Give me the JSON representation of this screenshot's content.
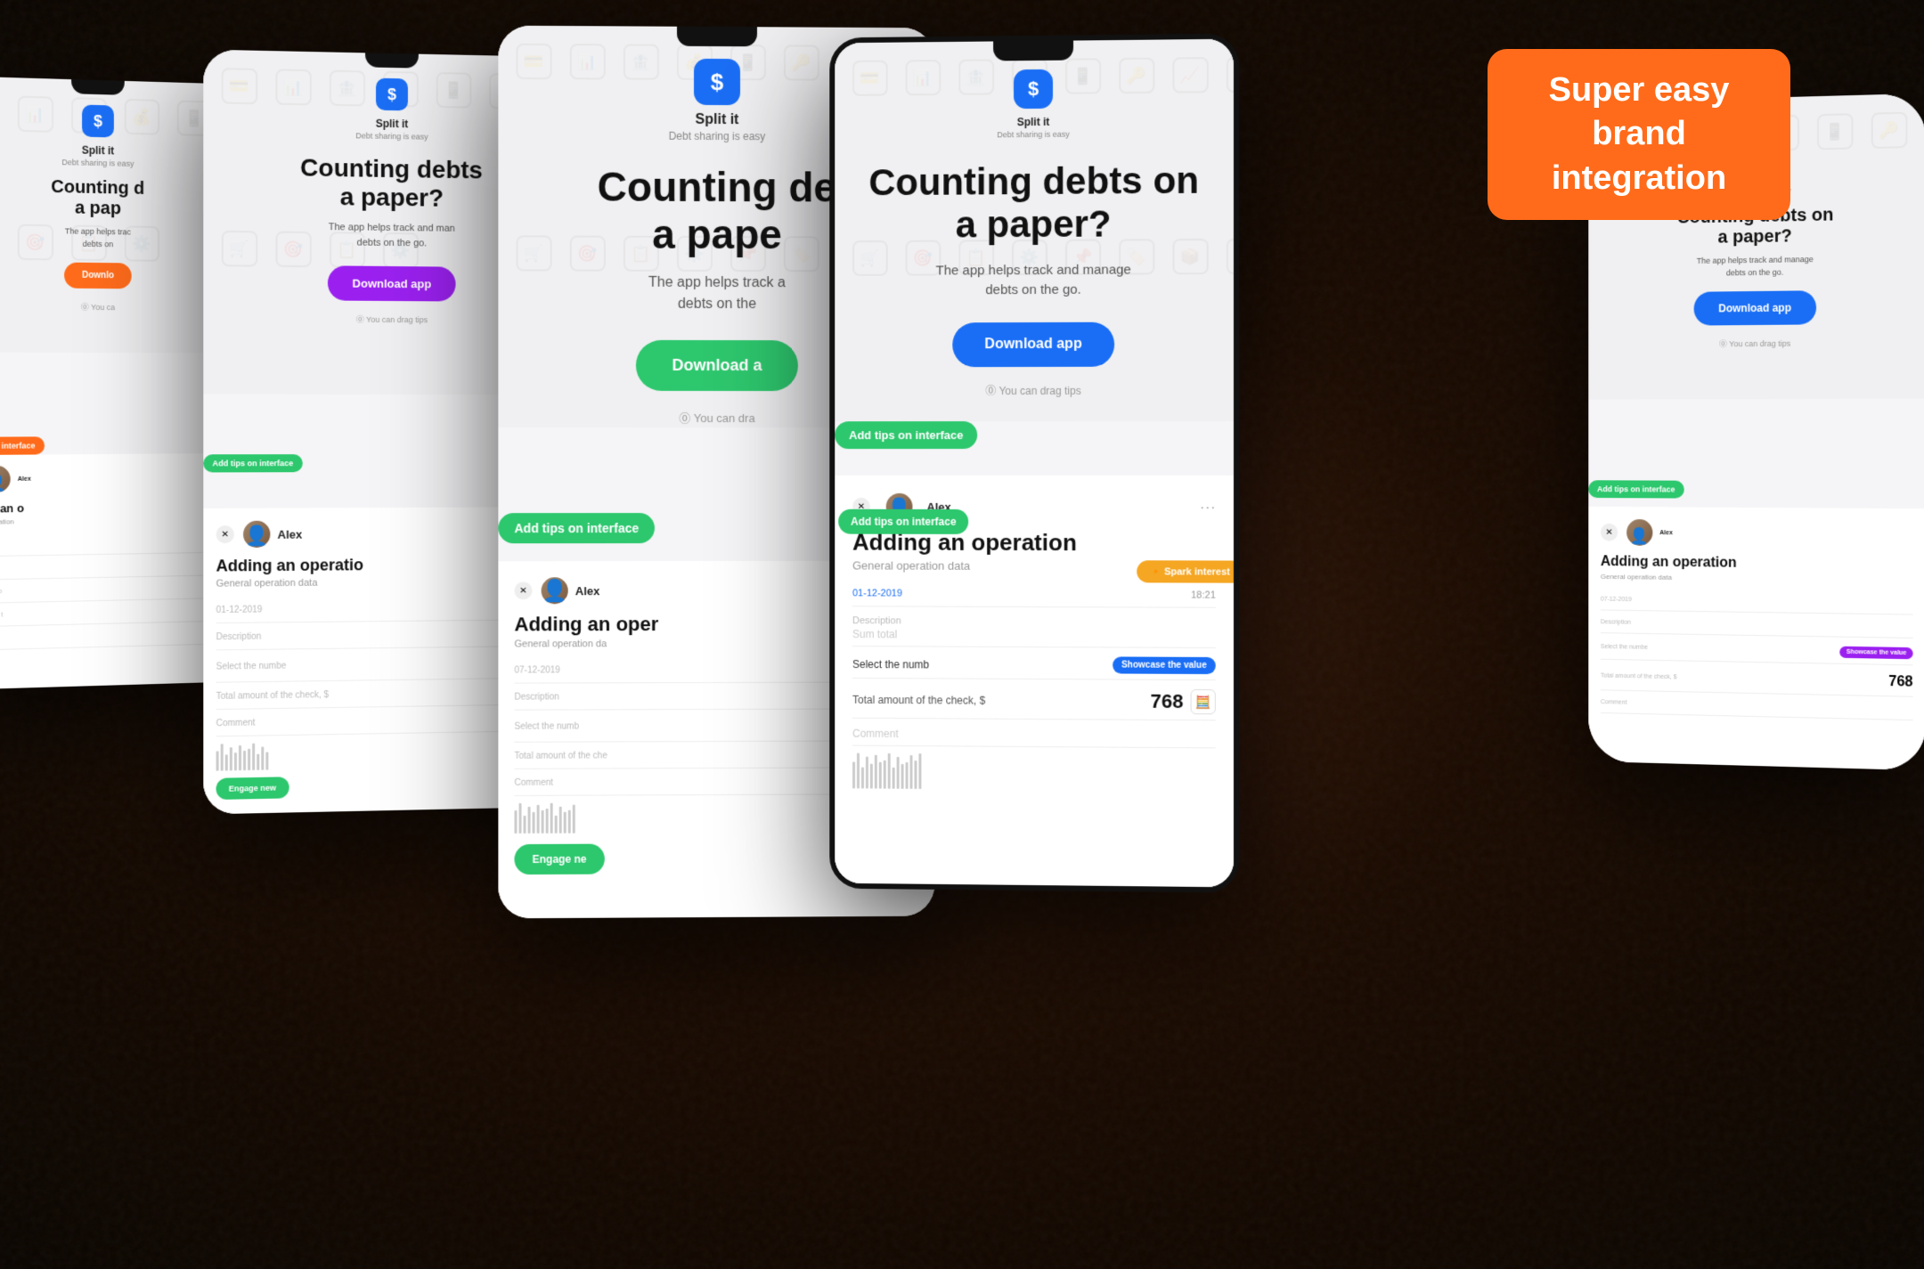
{
  "badge": {
    "text": "Super easy brand integration"
  },
  "app": {
    "name": "Split it",
    "tagline": "Debt sharing is easy",
    "headline": "Counting debts on a paper?",
    "description": "The app helps track and manage debts on the go."
  },
  "buttons": {
    "download": "Download app",
    "engage": "Engage new",
    "download_green": "Download a"
  },
  "tips": {
    "interface": "Add tips on interface",
    "drag": "You can drag tips",
    "showcase": "Showcase the value",
    "spark": "Spark interest",
    "engage_label": "Engage new"
  },
  "modal": {
    "title": "Adding an operation",
    "subtitle": "General operation data",
    "user": "Alex",
    "date": "01-12-2019",
    "description_label": "Description",
    "description_hint": "Sum total",
    "select_label": "Select the number, $",
    "total_label": "Total amount of the check, $",
    "total_value": "768",
    "comment_label": "Comment"
  }
}
